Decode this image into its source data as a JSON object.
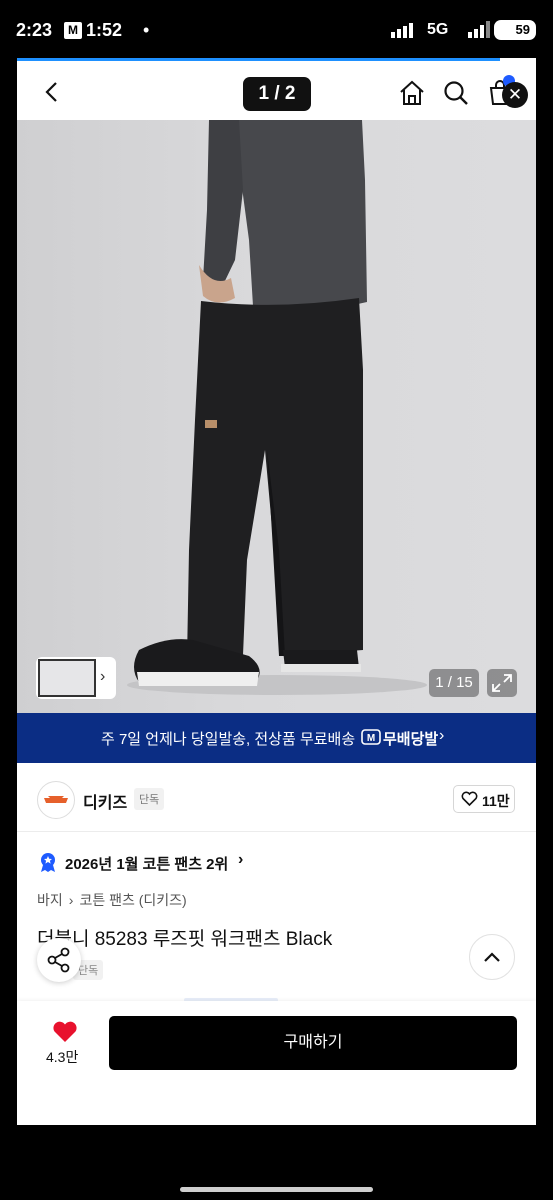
{
  "status_bar": {
    "time": "2:23",
    "app_badge": "M",
    "extra": "1:52",
    "dot": "•",
    "network": "5G",
    "battery": "59"
  },
  "header": {
    "pager": "1 / 2"
  },
  "gallery": {
    "counter": "1 / 15"
  },
  "promo": {
    "text": "주 7일 언제나 당일발송, 전상품 무료배송",
    "brand": "무배당발",
    "chevron": "›"
  },
  "brand": {
    "name": "디키즈",
    "tag": "단독",
    "likes": "11만"
  },
  "ranking": {
    "text": "2026년 1월 코튼 팬츠 2위",
    "chevron": "›"
  },
  "breadcrumb": [
    "바지",
    "›",
    "코튼 팬츠 (디키즈)"
  ],
  "product": {
    "title": "더블니 85283 루즈핏 워크팬츠 Black",
    "tag": "단독"
  },
  "bottom": {
    "like_count": "4.3만",
    "buy_label": "구매하기"
  },
  "colors": {
    "accent": "#1e90ff",
    "promo_bg": "#0b2d84",
    "heart": "#e8112d"
  }
}
